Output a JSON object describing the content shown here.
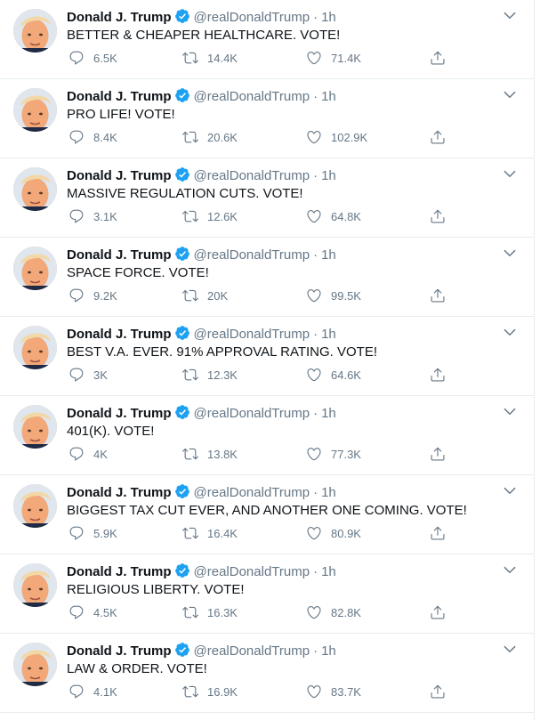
{
  "account": {
    "name": "Donald J. Trump",
    "handle": "@realDonaldTrump"
  },
  "colors": {
    "verified": "#1da1f2",
    "icon_gray": "#657786",
    "border": "#e6ecf0",
    "avatar_skin": "#f4b184",
    "avatar_hair": "#f2d8a6"
  },
  "icons": {
    "reply": "reply-icon",
    "retweet": "retweet-icon",
    "like": "heart-icon",
    "share": "share-icon",
    "menu": "chevron-down-icon",
    "verified": "verified-badge-icon"
  },
  "tweets": [
    {
      "text": "BETTER & CHEAPER HEALTHCARE. VOTE!",
      "time": "1h",
      "replies": "6.5K",
      "retweets": "14.4K",
      "likes": "71.4K"
    },
    {
      "text": "PRO LIFE! VOTE!",
      "time": "1h",
      "replies": "8.4K",
      "retweets": "20.6K",
      "likes": "102.9K"
    },
    {
      "text": "MASSIVE REGULATION CUTS. VOTE!",
      "time": "1h",
      "replies": "3.1K",
      "retweets": "12.6K",
      "likes": "64.8K"
    },
    {
      "text": "SPACE FORCE. VOTE!",
      "time": "1h",
      "replies": "9.2K",
      "retweets": "20K",
      "likes": "99.5K"
    },
    {
      "text": "BEST V.A. EVER. 91% APPROVAL RATING. VOTE!",
      "time": "1h",
      "replies": "3K",
      "retweets": "12.3K",
      "likes": "64.6K"
    },
    {
      "text": "401(K). VOTE!",
      "time": "1h",
      "replies": "4K",
      "retweets": "13.8K",
      "likes": "77.3K"
    },
    {
      "text": "BIGGEST TAX CUT EVER, AND ANOTHER ONE COMING. VOTE!",
      "time": "1h",
      "replies": "5.9K",
      "retweets": "16.4K",
      "likes": "80.9K"
    },
    {
      "text": "RELIGIOUS LIBERTY. VOTE!",
      "time": "1h",
      "replies": "4.5K",
      "retweets": "16.3K",
      "likes": "82.8K"
    },
    {
      "text": "LAW & ORDER. VOTE!",
      "time": "1h",
      "replies": "4.1K",
      "retweets": "16.9K",
      "likes": "83.7K"
    }
  ]
}
